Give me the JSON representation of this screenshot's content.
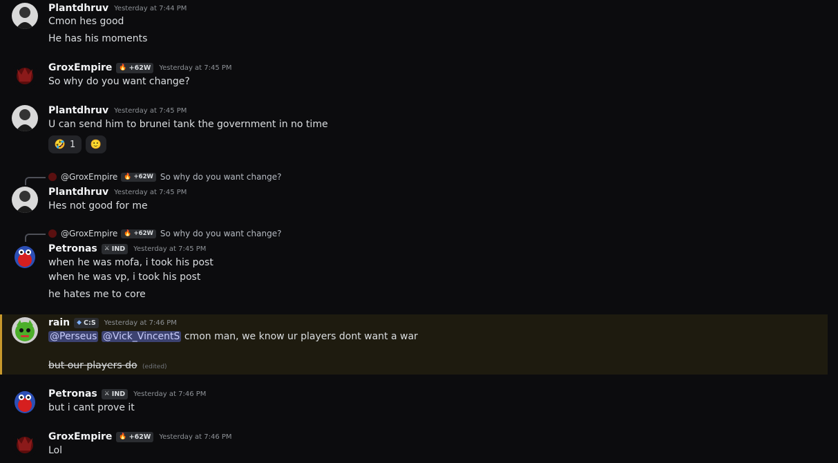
{
  "messages": [
    {
      "user": "Plantdhruv",
      "time": "Yesterday at 7:44 PM",
      "lines": [
        "Cmon hes good",
        "He has his moments"
      ]
    },
    {
      "user": "GroxEmpire",
      "tag": "+62W",
      "tag_icon": "fire-icon",
      "time": "Yesterday at 7:45 PM",
      "lines": [
        "So why do you want change?"
      ]
    },
    {
      "user": "Plantdhruv",
      "time": "Yesterday at 7:45 PM",
      "lines": [
        "U can send him to brunei tank the government in no time"
      ],
      "reactions": [
        {
          "emoji": "🤣",
          "count": "1"
        },
        {
          "emoji": "🙂",
          "count": ""
        }
      ]
    },
    {
      "reply": {
        "user": "@GroxEmpire",
        "tag": "+62W",
        "text": "So why do you want change?"
      },
      "user": "Plantdhruv",
      "time": "Yesterday at 7:45 PM",
      "lines": [
        "Hes not good for me"
      ]
    },
    {
      "reply": {
        "user": "@GroxEmpire",
        "tag": "+62W",
        "text": "So why do you want change?"
      },
      "user": "Petronas",
      "tag": "IND",
      "tag_icon": "swords-icon",
      "time": "Yesterday at 7:45 PM",
      "lines": [
        "when he was mofa, i took his post",
        "when he was vp, i took his post",
        "he hates me to core"
      ]
    },
    {
      "user": "rain",
      "tag": "C:S",
      "tag_icon": "shield-icon",
      "time": "Yesterday at 7:46 PM",
      "mentions": [
        "@Perseus",
        "@Vick_VincentS"
      ],
      "lines": [
        "cmon man, we know ur players dont want a war",
        "but our players do"
      ],
      "edited": "(edited)"
    },
    {
      "user": "Petronas",
      "tag": "IND",
      "tag_icon": "swords-icon",
      "time": "Yesterday at 7:46 PM",
      "lines": [
        "but i cant prove it"
      ]
    },
    {
      "user": "GroxEmpire",
      "tag": "+62W",
      "tag_icon": "fire-icon",
      "time": "Yesterday at 7:46 PM",
      "lines": [
        "Lol"
      ]
    }
  ],
  "colors": {
    "background": "#0c0c0e",
    "highlight": "#1e1b0f",
    "highlight_border": "#c8992c",
    "mention_bg": "#3c4270"
  }
}
